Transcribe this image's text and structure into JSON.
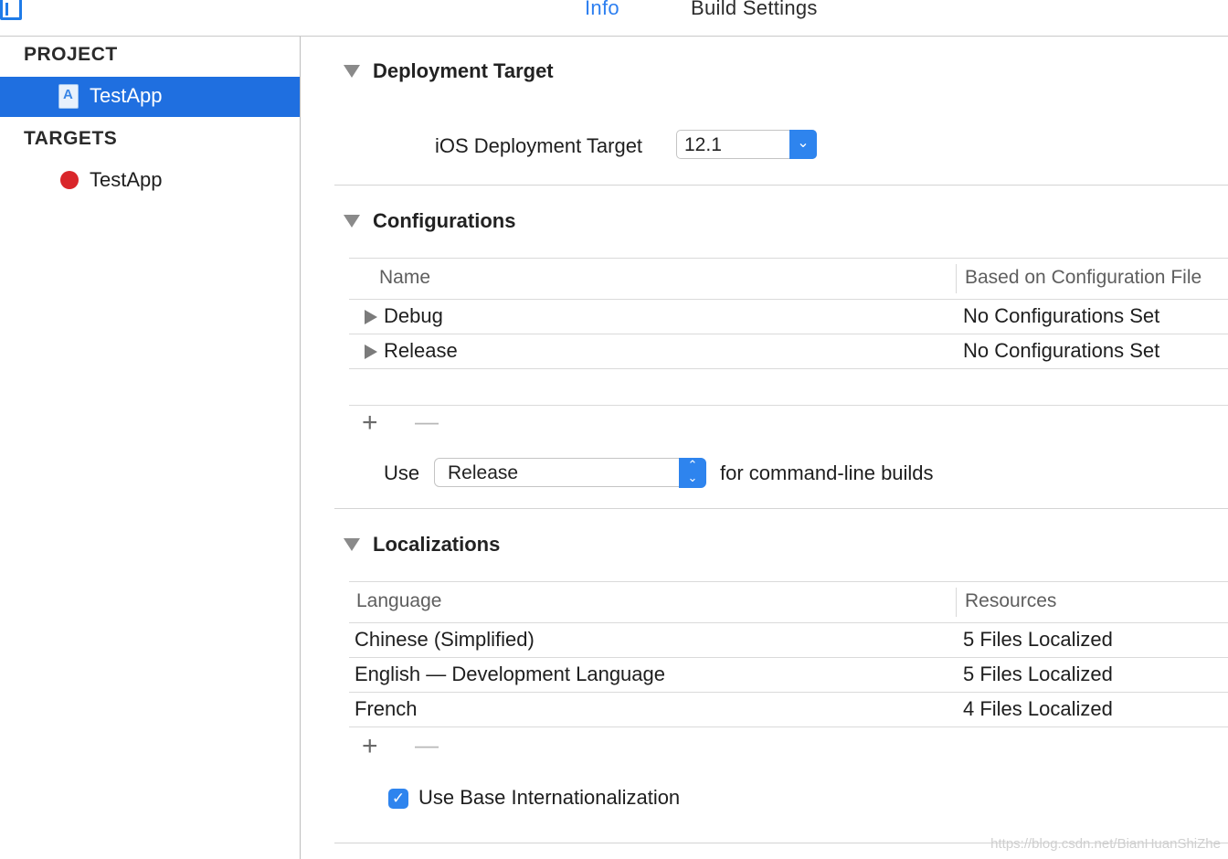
{
  "tabs": {
    "info": "Info",
    "build_settings": "Build Settings"
  },
  "sidebar": {
    "project_header": "PROJECT",
    "project_item": "TestApp",
    "targets_header": "TARGETS",
    "target_item": "TestApp"
  },
  "deployment": {
    "title": "Deployment Target",
    "ios_label": "iOS Deployment Target",
    "ios_value": "12.1"
  },
  "configurations": {
    "title": "Configurations",
    "columns": [
      "Name",
      "Based on Configuration File"
    ],
    "rows": [
      {
        "name": "Debug",
        "based_on": "No Configurations Set"
      },
      {
        "name": "Release",
        "based_on": "No Configurations Set"
      }
    ],
    "add": "+",
    "remove": "—",
    "use_label": "Use",
    "use_value": "Release",
    "use_suffix": "for command-line builds"
  },
  "localizations": {
    "title": "Localizations",
    "columns": [
      "Language",
      "Resources"
    ],
    "rows": [
      {
        "language": "Chinese (Simplified)",
        "resources": "5 Files Localized"
      },
      {
        "language": "English — Development Language",
        "resources": "5 Files Localized"
      },
      {
        "language": "French",
        "resources": "4 Files Localized"
      }
    ],
    "add": "+",
    "remove": "—",
    "use_base_label": "Use Base Internationalization",
    "use_base_checked": true
  },
  "watermark": "https://blog.csdn.net/BianHuanShiZhe",
  "colors": {
    "accent": "#2e84ee",
    "selection": "#1f6fe0",
    "target_dot": "#d9262a"
  }
}
